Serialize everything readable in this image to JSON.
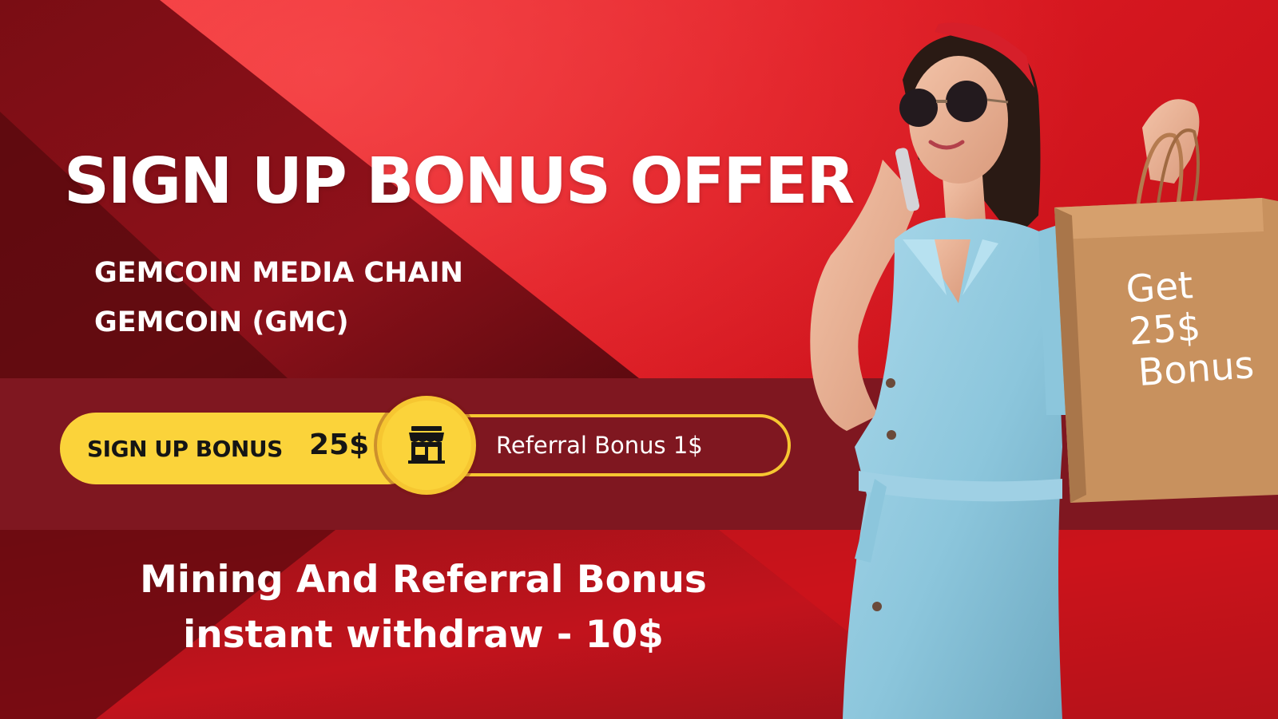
{
  "headline": "SIGN UP BONUS OFFER",
  "subtitle": {
    "line1": "GEMCOIN MEDIA CHAIN",
    "line2": "GEMCOIN (GMC)"
  },
  "signup_bonus": {
    "label": "SIGN UP BONUS",
    "amount": "25$",
    "icon": "store-icon"
  },
  "referral": {
    "label": "Referral Bonus 1$"
  },
  "bottom": {
    "line1": "Mining And Referral Bonus",
    "line2": "instant withdraw - 10$"
  },
  "bag": {
    "line1": "Get",
    "line2": "25$",
    "line3": "Bonus"
  },
  "colors": {
    "background_red": "#c8101a",
    "dark_red": "#7f1720",
    "accent_yellow": "#fbd33a",
    "text_white": "#ffffff",
    "text_dark": "#151515"
  }
}
